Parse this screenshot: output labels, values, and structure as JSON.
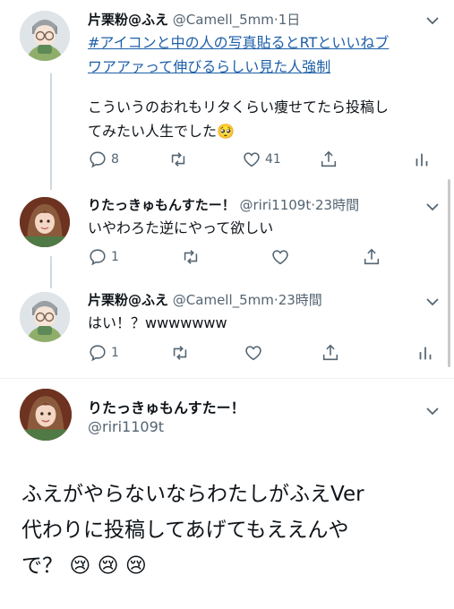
{
  "tweets": [
    {
      "name": "片栗粉@ふえ",
      "handle": "@Camell_5mm",
      "time": "1日",
      "hashtag_line1": "#アイコンと中の人の写真貼るとRTといいねブ",
      "hashtag_line2": "ワアアァって伸びるらしい見た人強制",
      "body_line1": "こういうのおれもリタくらい痩せてたら投稿し",
      "body_line2": "てみたい人生でした",
      "emoji": "🥺",
      "reply_count": "8",
      "retweet_count": "",
      "like_count": "41"
    },
    {
      "name": "りたっきゅもんすたー！",
      "handle": "@riri1109t",
      "time": "23時間",
      "body": "いやわろた逆にやって欲しい",
      "reply_count": "1",
      "retweet_count": "",
      "like_count": ""
    },
    {
      "name": "片栗粉@ふえ",
      "handle": "@Camell_5mm",
      "time": "23時間",
      "body": "はい！？wwwwwww",
      "reply_count": "1",
      "retweet_count": "",
      "like_count": ""
    }
  ],
  "main_tweet": {
    "name": "りたっきゅもんすたー！",
    "handle": "@riri1109t",
    "body_line1": "ふえがやらないならわたしがふえVer",
    "body_line2": "代わりに投稿してあげてもええんや",
    "body_line3": "で？",
    "emojis": "😢 😢 😢"
  },
  "meta_separator": "·",
  "icons": {
    "reply": "reply-icon",
    "retweet": "retweet-icon",
    "like": "heart-icon",
    "share": "share-icon",
    "analytics": "analytics-icon",
    "more": "chevron-down-icon"
  },
  "colors": {
    "text": "#0f1419",
    "secondary": "#536471",
    "link": "#1d5fa8",
    "thread_line": "#cfd9de"
  }
}
